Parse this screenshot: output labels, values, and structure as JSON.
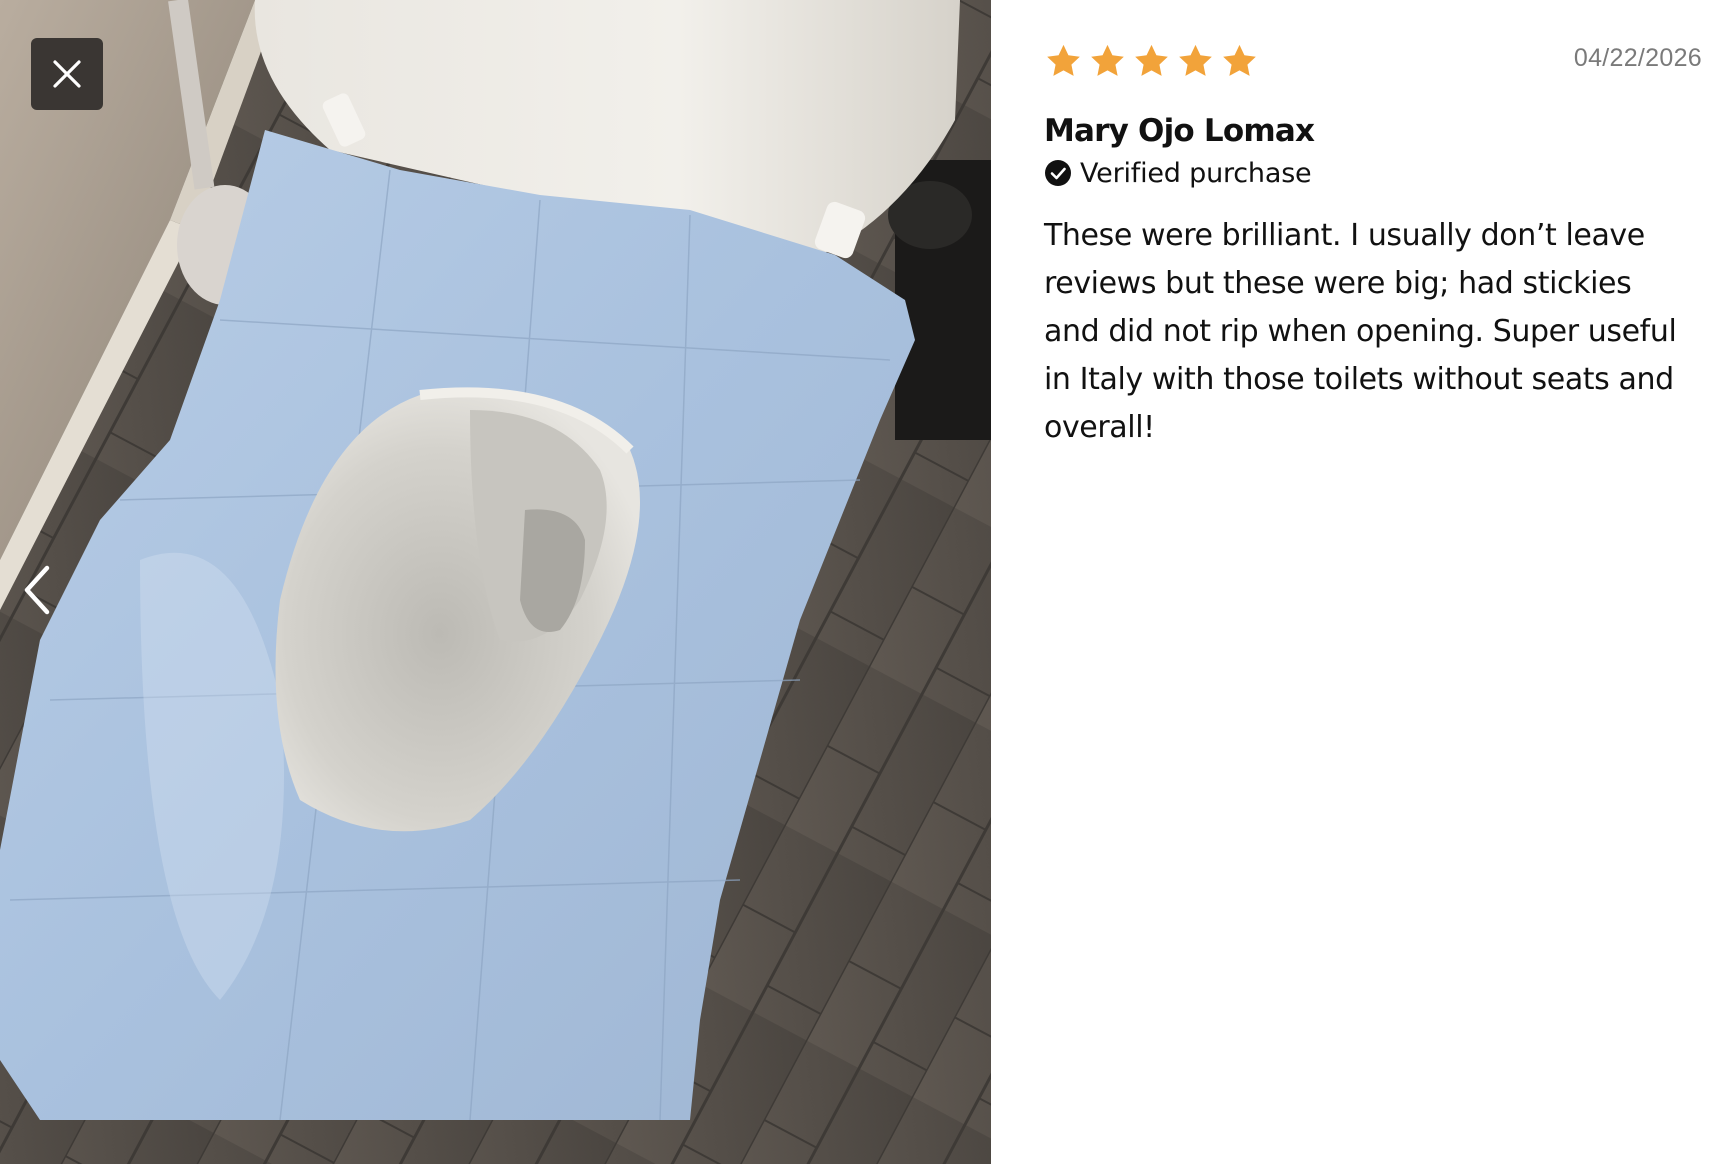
{
  "gallery": {
    "close_icon": "close-icon",
    "prev_icon": "chevron-left-icon",
    "image_alt": "Customer photo of a disposable blue toilet seat cover on a toilet"
  },
  "review": {
    "rating": 5,
    "rating_max": 5,
    "star_color": "#F2A33A",
    "date": "04/22/2026",
    "author": "Mary Ojo Lomax",
    "verified_label": "Verified purchase",
    "body": "These were brilliant. I usually don’t leave reviews but these were big; had stickies and did not rip when opening. Super useful in Italy with those toilets without seats and overall!"
  }
}
